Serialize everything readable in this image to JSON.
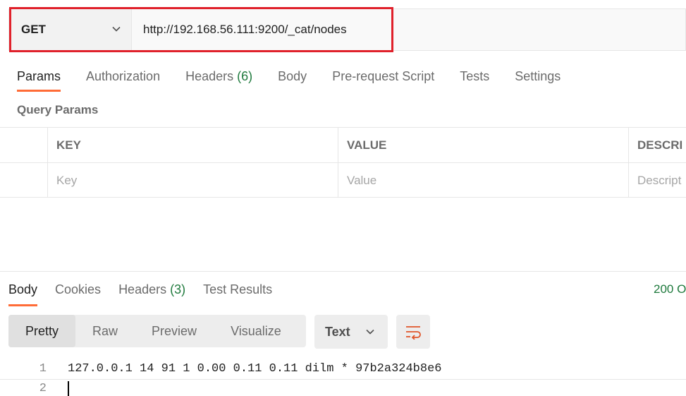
{
  "request": {
    "method": "GET",
    "url": "http://192.168.56.111:9200/_cat/nodes"
  },
  "request_tabs": [
    {
      "label": "Params",
      "count": ""
    },
    {
      "label": "Authorization",
      "count": ""
    },
    {
      "label": "Headers",
      "count": "(6)"
    },
    {
      "label": "Body",
      "count": ""
    },
    {
      "label": "Pre-request Script",
      "count": ""
    },
    {
      "label": "Tests",
      "count": ""
    },
    {
      "label": "Settings",
      "count": ""
    }
  ],
  "query_params": {
    "title": "Query Params",
    "headers": {
      "key": "KEY",
      "value": "VALUE",
      "description": "DESCRI"
    },
    "placeholders": {
      "key": "Key",
      "value": "Value",
      "description": "Descript"
    }
  },
  "response_tabs": [
    {
      "label": "Body",
      "count": ""
    },
    {
      "label": "Cookies",
      "count": ""
    },
    {
      "label": "Headers",
      "count": "(3)"
    },
    {
      "label": "Test Results",
      "count": ""
    }
  ],
  "status": "200 O",
  "view_modes": [
    "Pretty",
    "Raw",
    "Preview",
    "Visualize"
  ],
  "format": "Text",
  "code_lines": [
    {
      "no": "1",
      "text": "127.0.0.1 14 91 1 0.00 0.11 0.11 dilm * 97b2a324b8e6"
    },
    {
      "no": "2",
      "text": ""
    }
  ],
  "colors": {
    "accent": "#ff6c37",
    "highlight": "#e0212b",
    "success": "#1f7a3d"
  },
  "icons": {
    "dropdown": "chevron-down-icon",
    "wrap": "wrap-lines-icon"
  }
}
